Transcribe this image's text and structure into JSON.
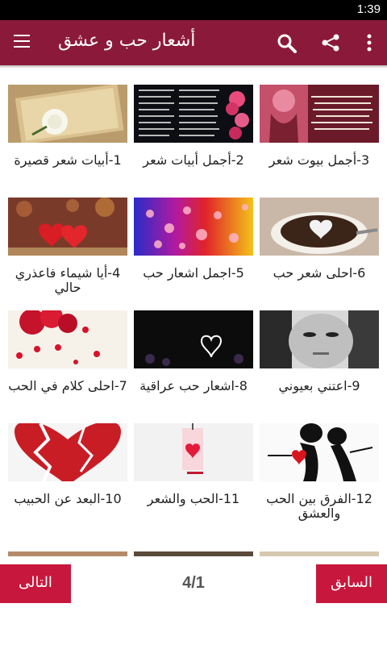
{
  "status_bar": {
    "time": "1:39"
  },
  "app_bar": {
    "title": "أشعار حب و عشق"
  },
  "cards": [
    {
      "title": "1-أبيات شعر قصيرة"
    },
    {
      "title": "2-أجمل أبيات شعر"
    },
    {
      "title": "3-أجمل بيوت شعر"
    },
    {
      "title": "4-أيا شيماء فاعذري حالي"
    },
    {
      "title": "5-اجمل اشعار حب"
    },
    {
      "title": "6-احلى شعر حب"
    },
    {
      "title": "7-احلى كلام في الحب"
    },
    {
      "title": "8-اشعار حب عراقية"
    },
    {
      "title": "9-اعتني بعيوني"
    },
    {
      "title": "10-البعد عن الحبيب"
    },
    {
      "title": "11-الحب والشعر"
    },
    {
      "title": "12-الفرق بين الحب والعشق"
    }
  ],
  "pagination": {
    "next_label": "التالى",
    "prev_label": "السابق",
    "page_indicator": "4/1"
  },
  "colors": {
    "app_bar": "#8b1a3a",
    "button": "#c8173c"
  }
}
